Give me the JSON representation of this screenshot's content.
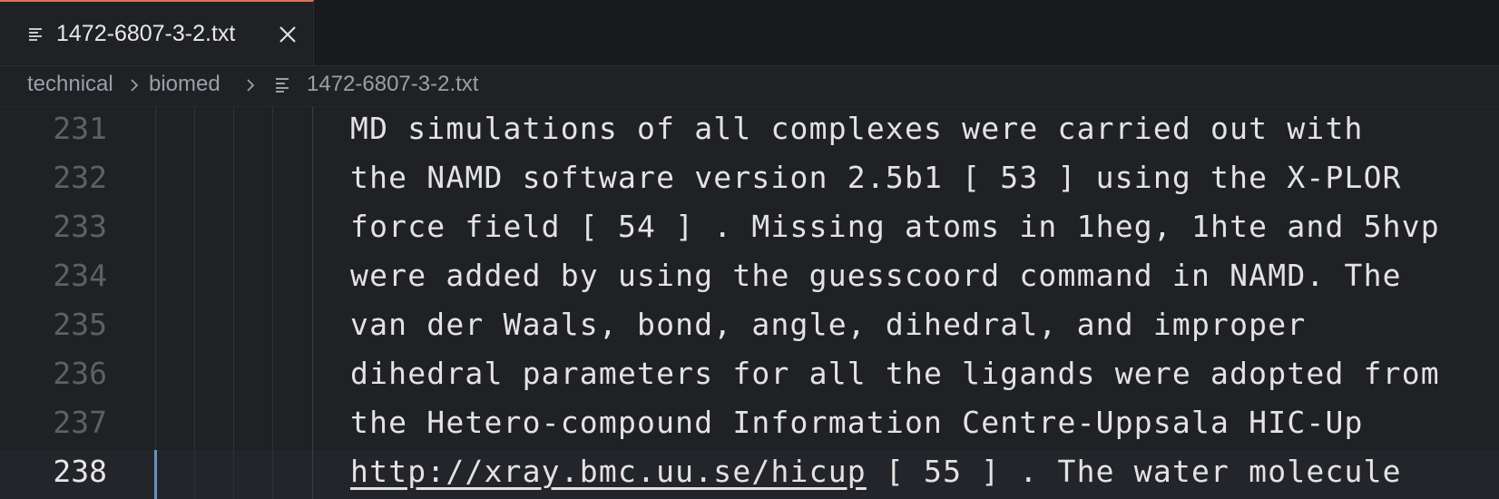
{
  "tab": {
    "label": "1472-6807-3-2.txt",
    "close_icon": "close-icon",
    "file_icon": "text-file-icon",
    "accent_color": "#d8735a"
  },
  "breadcrumb": {
    "items": [
      "technical",
      "biomed",
      "1472-6807-3-2.txt"
    ]
  },
  "editor": {
    "current_line": "238",
    "line_numbers": [
      "231",
      "232",
      "233",
      "234",
      "235",
      "236",
      "237",
      "238"
    ],
    "lines": [
      "MD simulations of all complexes were carried out with",
      "the NAMD software version 2.5b1 [ 53 ] using the X-PLOR",
      "force field [ 54 ] . Missing atoms in 1heg, 1hte and 5hvp",
      "were added by using the guesscoord command in NAMD. The",
      "van der Waals, bond, angle, dihedral, and improper",
      "dihedral parameters for all the ligands were adopted from",
      "the Hetero-compound Information Centre-Uppsala HIC-Up"
    ],
    "last_line": {
      "link": "http://xray.bmc.uu.se/hicup",
      "rest": " [ 55 ] . The water molecule"
    }
  }
}
